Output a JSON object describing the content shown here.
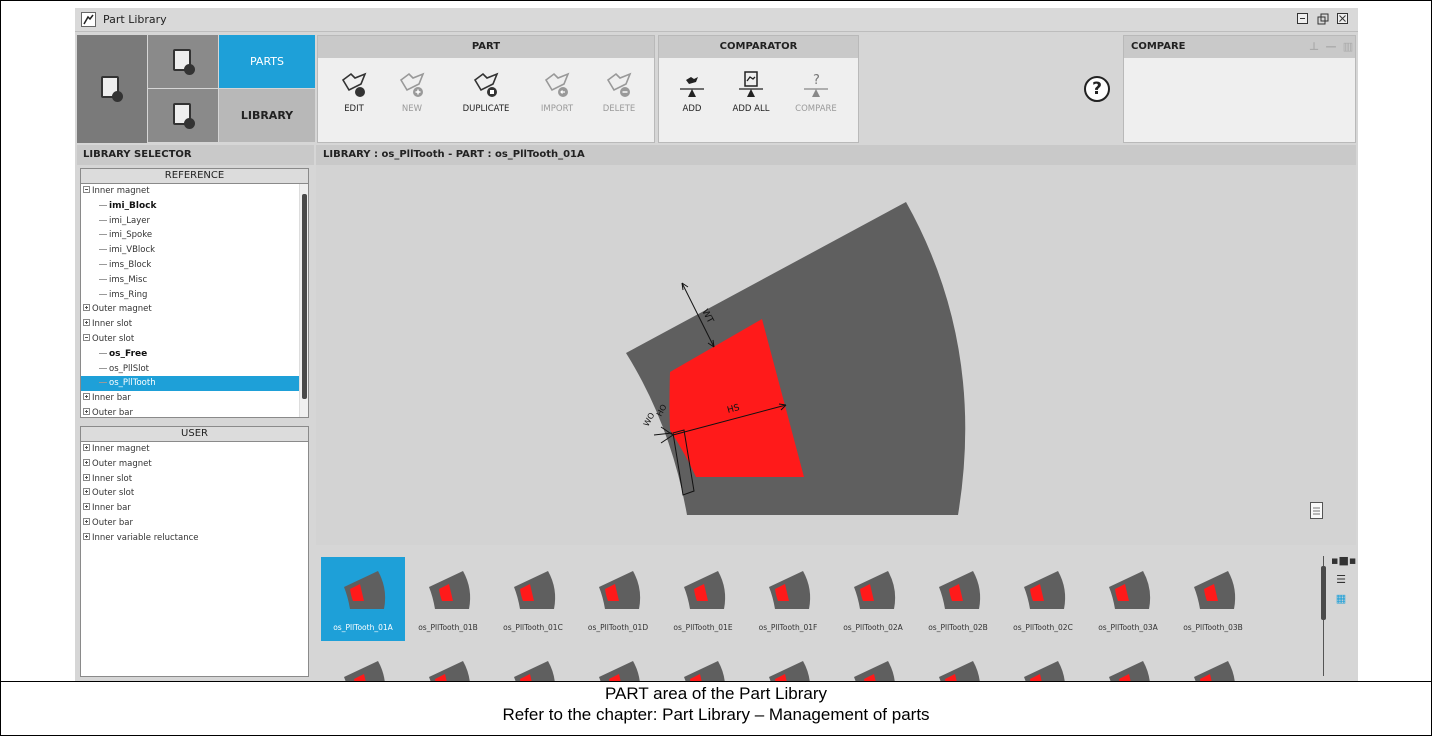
{
  "window": {
    "title": "Part Library",
    "controls": [
      "minimize",
      "restore",
      "close"
    ]
  },
  "mode": {
    "parts_label": "PARTS",
    "library_label": "LIBRARY"
  },
  "part_group": {
    "title": "PART",
    "tools": [
      {
        "label": "EDIT",
        "icon": "edit-part-icon",
        "enabled": true
      },
      {
        "label": "NEW",
        "icon": "new-part-icon",
        "enabled": false
      },
      {
        "label": "DUPLICATE",
        "icon": "duplicate-part-icon",
        "enabled": true
      },
      {
        "label": "IMPORT",
        "icon": "import-part-icon",
        "enabled": false
      },
      {
        "label": "DELETE",
        "icon": "delete-part-icon",
        "enabled": false
      }
    ]
  },
  "comparator_group": {
    "title": "COMPARATOR",
    "tools": [
      {
        "label": "ADD",
        "icon": "add-to-comparator-icon",
        "enabled": true
      },
      {
        "label": "ADD ALL",
        "icon": "add-all-to-comparator-icon",
        "enabled": true
      },
      {
        "label": "COMPARE",
        "icon": "compare-icon",
        "enabled": false
      }
    ]
  },
  "compare_panel": {
    "title": "COMPARE"
  },
  "library_selector": {
    "title": "LIBRARY SELECTOR",
    "reference": {
      "title": "REFERENCE",
      "rows": [
        {
          "label": "Inner magnet",
          "level": 0,
          "expander": "minus"
        },
        {
          "label": "imi_Block",
          "level": 1,
          "bold": true
        },
        {
          "label": "imi_Layer",
          "level": 1
        },
        {
          "label": "imi_Spoke",
          "level": 1
        },
        {
          "label": "imi_VBlock",
          "level": 1
        },
        {
          "label": "ims_Block",
          "level": 1
        },
        {
          "label": "ims_Misc",
          "level": 1
        },
        {
          "label": "ims_Ring",
          "level": 1
        },
        {
          "label": "Outer magnet",
          "level": 0,
          "expander": "plus"
        },
        {
          "label": "Inner slot",
          "level": 0,
          "expander": "plus"
        },
        {
          "label": "Outer slot",
          "level": 0,
          "expander": "minus"
        },
        {
          "label": "os_Free",
          "level": 1,
          "bold": true
        },
        {
          "label": "os_PllSlot",
          "level": 1
        },
        {
          "label": "os_PllTooth",
          "level": 1,
          "selected": true
        },
        {
          "label": "Inner bar",
          "level": 0,
          "expander": "plus"
        },
        {
          "label": "Outer bar",
          "level": 0,
          "expander": "plus"
        }
      ]
    },
    "user": {
      "title": "USER",
      "rows": [
        {
          "label": "Inner magnet",
          "level": 0,
          "expander": "plus"
        },
        {
          "label": "Outer magnet",
          "level": 0,
          "expander": "plus"
        },
        {
          "label": "Inner slot",
          "level": 0,
          "expander": "plus"
        },
        {
          "label": "Outer slot",
          "level": 0,
          "expander": "plus"
        },
        {
          "label": "Inner bar",
          "level": 0,
          "expander": "plus"
        },
        {
          "label": "Outer bar",
          "level": 0,
          "expander": "plus"
        },
        {
          "label": "Inner variable reluctance",
          "level": 0,
          "expander": "plus"
        }
      ]
    }
  },
  "view": {
    "header": "LIBRARY : os_PllTooth   -   PART : os_PllTooth_01A",
    "dimension_labels": [
      "WT",
      "HS",
      "HO",
      "WO"
    ],
    "colors": {
      "yoke": "#5f5f5f",
      "slot": "#ff1a1a",
      "background": "#d3d3d3"
    }
  },
  "thumbnails": {
    "items": [
      "os_PllTooth_01A",
      "os_PllTooth_01B",
      "os_PllTooth_01C",
      "os_PllTooth_01D",
      "os_PllTooth_01E",
      "os_PllTooth_01F",
      "os_PllTooth_02A",
      "os_PllTooth_02B",
      "os_PllTooth_02C",
      "os_PllTooth_03A",
      "os_PllTooth_03B"
    ],
    "selected": "os_PllTooth_01A",
    "view_modes": [
      "large-icons-view-icon",
      "list-view-icon",
      "grid-view-icon"
    ],
    "accent": "#1ea0d8"
  },
  "caption": {
    "line1": "PART area of the Part Library",
    "line2": "Refer to the chapter: Part Library – Management of parts"
  }
}
